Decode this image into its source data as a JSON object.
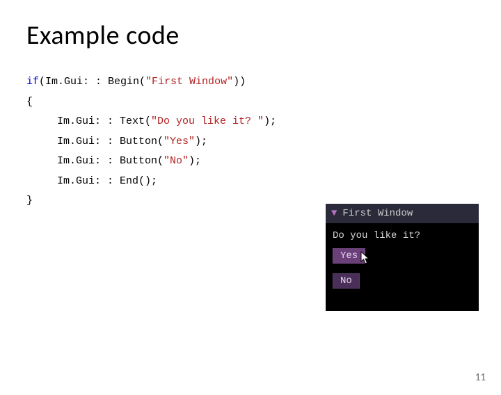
{
  "title": "Example code",
  "code": {
    "line1_pre": "if",
    "line1_post": "(Im.Gui: : Begin(",
    "str1": "\"First Window\"",
    "line1_end": "))",
    "brace_open": "{",
    "l2a": "Im.Gui: : Text(",
    "str2": "\"Do you like it? \"",
    "l2b": ");",
    "l3a": "Im.Gui: : Button(",
    "str3": "\"Yes\"",
    "l3b": ");",
    "l4a": "Im.Gui: : Button(",
    "str4": "\"No\"",
    "l4b": ");",
    "l5": "Im.Gui: : End();",
    "brace_close": "}"
  },
  "window": {
    "title": "First Window",
    "text": "Do you like it?",
    "btn_yes": "Yes",
    "btn_no": "No"
  },
  "page_number": "11"
}
